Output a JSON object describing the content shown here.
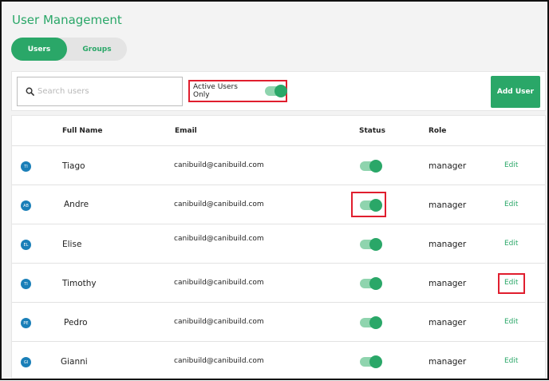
{
  "page": {
    "title": "User Management"
  },
  "tabs": [
    {
      "label": "Users"
    },
    {
      "label": "Groups"
    }
  ],
  "toolbar": {
    "search_placeholder": "Search users",
    "active_toggle_label": "Active Users Only",
    "active_toggle_on": true,
    "add_user_label": "Add User"
  },
  "table": {
    "headers": {
      "name": "Full Name",
      "email": "Email",
      "status": "Status",
      "role": "Role"
    },
    "edit_label": "Edit",
    "rows": [
      {
        "initials": "TI",
        "name": "Tiago",
        "email": "canibuild@canibuild.com",
        "active": true,
        "role": "manager"
      },
      {
        "initials": "AB",
        "name": "Andre",
        "email": "canibuild@canibuild.com",
        "active": true,
        "role": "manager"
      },
      {
        "initials": "EL",
        "name": "Elise",
        "email": "canibuild@canibuild.com",
        "active": true,
        "role": "manager"
      },
      {
        "initials": "TI",
        "name": "Timothy",
        "email": "canibuild@canibuild.com",
        "active": true,
        "role": "manager"
      },
      {
        "initials": "PE",
        "name": "Pedro",
        "email": "canibuild@canibuild.com",
        "active": true,
        "role": "manager"
      },
      {
        "initials": "GI",
        "name": "Gianni",
        "email": "canibuild@canibuild.com",
        "active": true,
        "role": "manager"
      }
    ]
  },
  "colors": {
    "accent": "#2aa768",
    "avatar": "#1a7fb8",
    "highlight": "#e01e2e"
  }
}
